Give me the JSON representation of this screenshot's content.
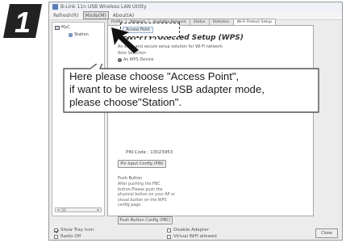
{
  "step_badge": {
    "number": "1"
  },
  "window": {
    "title": "B-Link 11n USB Wireless LAN Utility",
    "menus": [
      "Refresh(R)",
      "Mode(M)",
      "About(A)"
    ],
    "active_menu_index": 1
  },
  "tree": {
    "root_label": "MyC",
    "child_label": "Station",
    "scroll_left": "◄",
    "scroll_right": "►"
  },
  "tabs": [
    "Profile",
    "Network",
    "Available Network",
    "Status",
    "Statistics",
    "Wi-Fi Protect Setup"
  ],
  "selected_tab_index": 5,
  "mode_dropdown": {
    "options": [
      "Access Point"
    ]
  },
  "wps": {
    "title": "Wi-Fi Protected Setup (WPS)",
    "description": "An easy and secure setup solution for Wi-Fi network",
    "role_label": "Role Selection",
    "role_option": "As WPS Device",
    "pin_label": "PIN Code :",
    "pin_value": "13023953",
    "pin_button": "Pin Input Config (PIN)",
    "push_button_heading": "Push Button",
    "push_button_description": "After pushing the PBC button.Please push the physical button on your AP or visual button on the WPS config page.",
    "pbc_button": "Push Button Config (PBC)"
  },
  "bottom": {
    "show_tray_icon": "Show Tray Icon",
    "show_tray_icon_checked": true,
    "radio_off": "Radio Off",
    "radio_off_checked": false,
    "disable_adapter": "Disable Adapter",
    "disable_adapter_checked": false,
    "virtual_wifi": "Virtual WiFi allowed",
    "virtual_wifi_checked": false,
    "close_button": "Close"
  },
  "callout": {
    "line1": "Here please choose \"Access Point\",",
    "line2": "if want to be wireless USB adapter mode,",
    "line3": "please choose\"Station\"."
  },
  "colors": {
    "badge": "#222222",
    "arrow": "#111111",
    "callout_border": "#555555"
  }
}
